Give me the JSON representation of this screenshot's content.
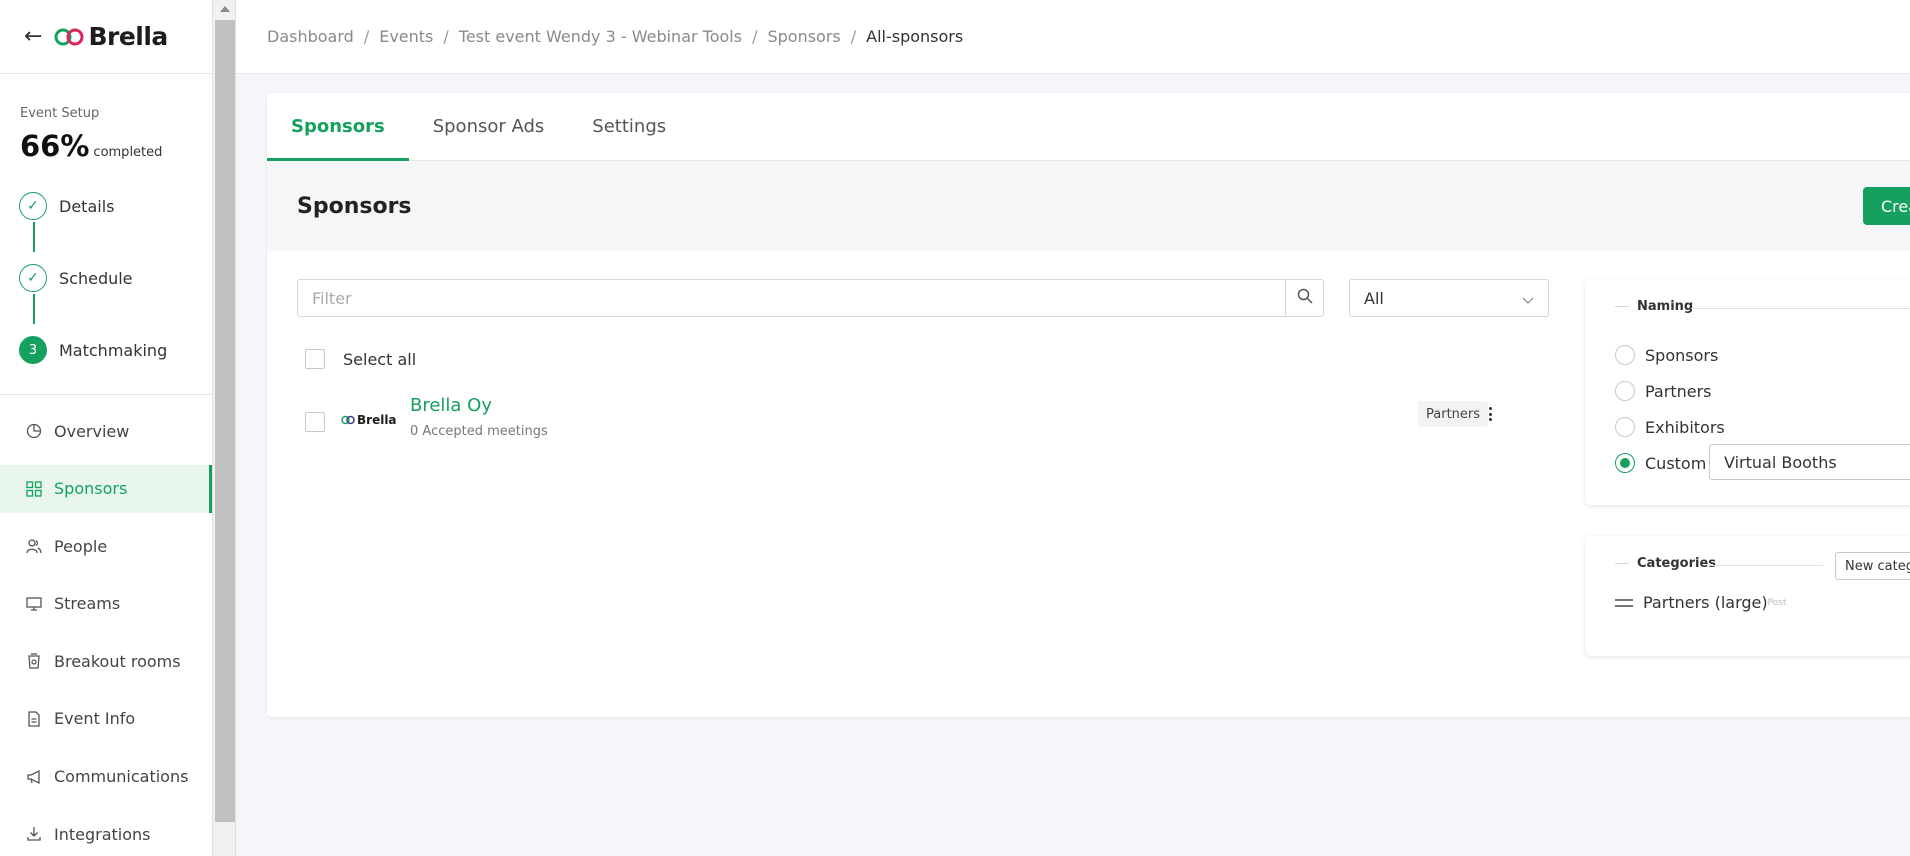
{
  "app": {
    "logo_text": "Brella",
    "brand_color": "#16a05f"
  },
  "breadcrumb": [
    "Dashboard",
    "Events",
    "Test event Wendy 3 - Webinar Tools",
    "Sponsors",
    "All-sponsors"
  ],
  "setup": {
    "label": "Event Setup",
    "percent": "66%",
    "completed_text": "completed",
    "steps": [
      {
        "label": "Details",
        "state": "done",
        "icon": "check-icon"
      },
      {
        "label": "Schedule",
        "state": "done",
        "icon": "check-icon"
      },
      {
        "label": "Matchmaking",
        "state": "current",
        "number": "3"
      }
    ]
  },
  "nav": [
    {
      "label": "Overview",
      "icon": "pie-chart-icon"
    },
    {
      "label": "Sponsors",
      "icon": "grid-icon",
      "active": true
    },
    {
      "label": "People",
      "icon": "people-icon"
    },
    {
      "label": "Streams",
      "icon": "monitor-icon"
    },
    {
      "label": "Breakout rooms",
      "icon": "cup-icon"
    },
    {
      "label": "Event Info",
      "icon": "document-icon"
    },
    {
      "label": "Communications",
      "icon": "megaphone-icon"
    },
    {
      "label": "Integrations",
      "icon": "download-icon"
    }
  ],
  "tabs": [
    {
      "label": "Sponsors",
      "active": true
    },
    {
      "label": "Sponsor Ads"
    },
    {
      "label": "Settings"
    }
  ],
  "main": {
    "title": "Sponsors",
    "create_button": "Crea",
    "filter_placeholder": "Filter",
    "select_value": "All",
    "select_all_label": "Select all",
    "sponsors": [
      {
        "name": "Brella Oy",
        "logo_text": "Brella",
        "meetings": "0 Accepted meetings",
        "badge": "Partners"
      }
    ]
  },
  "naming": {
    "legend": "Naming",
    "options": [
      {
        "label": "Sponsors",
        "checked": false
      },
      {
        "label": "Partners",
        "checked": false
      },
      {
        "label": "Exhibitors",
        "checked": false
      },
      {
        "label": "Custom",
        "checked": true
      }
    ],
    "custom_value": "Virtual Booths"
  },
  "categories": {
    "legend": "Categories",
    "new_button": "New categ",
    "items": [
      {
        "label": "Partners (large)",
        "sub": "Post"
      }
    ]
  }
}
